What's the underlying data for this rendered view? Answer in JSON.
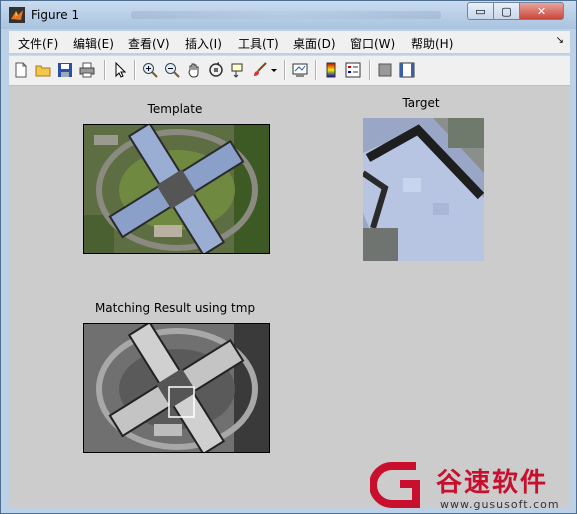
{
  "window": {
    "title": "Figure 1",
    "controls": {
      "minimize": "▭",
      "maximize": "▢",
      "close": "✕"
    }
  },
  "menu": {
    "items": [
      {
        "label": "文件(F)"
      },
      {
        "label": "编辑(E)"
      },
      {
        "label": "查看(V)"
      },
      {
        "label": "插入(I)"
      },
      {
        "label": "工具(T)"
      },
      {
        "label": "桌面(D)"
      },
      {
        "label": "窗口(W)"
      },
      {
        "label": "帮助(H)"
      }
    ],
    "overflow_glyph": "↘"
  },
  "toolbar": {
    "icons": [
      "new-figure-icon",
      "open-file-icon",
      "save-icon",
      "print-icon",
      "edit-plot-arrow-icon",
      "zoom-in-icon",
      "zoom-out-icon",
      "pan-hand-icon",
      "rotate-3d-icon",
      "data-cursor-icon",
      "brush-icon",
      "brush-dropdown-icon",
      "link-plot-icon",
      "colorbar-icon",
      "legend-icon",
      "hide-plot-tools-icon",
      "show-plot-tools-icon"
    ]
  },
  "figure": {
    "axes": [
      {
        "title": "Template"
      },
      {
        "title": "Target"
      },
      {
        "title": "Matching Result using tmp"
      }
    ]
  },
  "watermark": {
    "brand": "谷速软件",
    "url": "www.gususoft.com",
    "color": "#c8102e"
  }
}
